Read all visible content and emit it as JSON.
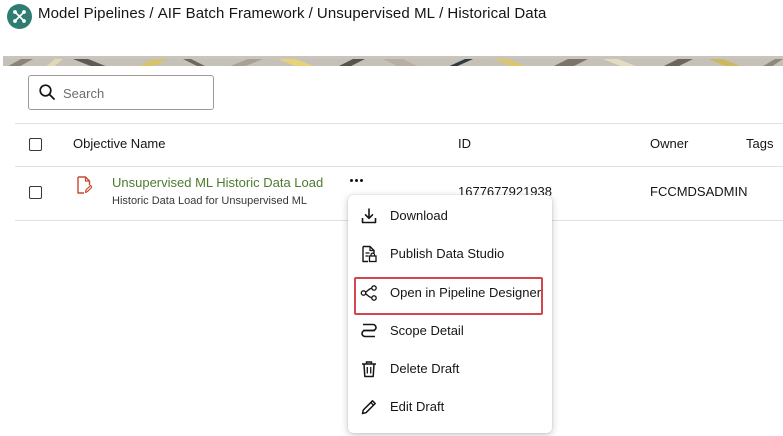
{
  "header": {
    "breadcrumb": [
      "Model Pipelines",
      "AIF Batch Framework",
      "Unsupervised ML",
      "Historical Data"
    ],
    "separator": "/",
    "logo_icon": "pipeline-hub-icon",
    "logo_color": "#2f7d72"
  },
  "search": {
    "placeholder": "Search",
    "value": ""
  },
  "table": {
    "headers": {
      "name": "Objective Name",
      "id": "ID",
      "owner": "Owner",
      "tags": "Tags"
    },
    "rows": [
      {
        "name": "Unsupervised ML Historic Data Load",
        "description": "Historic Data Load for Unsupervised ML",
        "id": "1677677921938",
        "owner": "FCCMDSADMIN",
        "icon": "edit-document-icon"
      }
    ]
  },
  "context_menu": {
    "items": [
      {
        "label": "Download",
        "icon": "download-icon"
      },
      {
        "label": "Publish Data Studio",
        "icon": "publish-document-icon"
      },
      {
        "label": "Open in Pipeline Designer",
        "icon": "pipeline-icon",
        "highlighted": true
      },
      {
        "label": "Scope Detail",
        "icon": "scope-icon"
      },
      {
        "label": "Delete Draft",
        "icon": "trash-icon"
      },
      {
        "label": "Edit Draft",
        "icon": "pencil-icon"
      }
    ]
  },
  "colors": {
    "link_green": "#4d7b2e",
    "highlight_red": "#d3454f",
    "file_icon_orange": "#c6492b"
  }
}
